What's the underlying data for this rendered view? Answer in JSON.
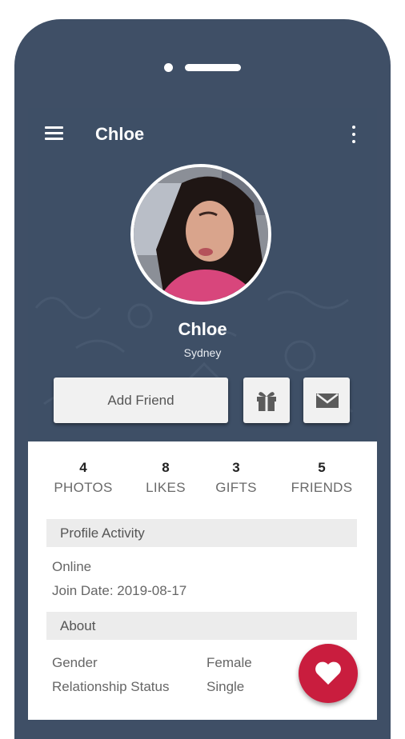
{
  "appbar": {
    "title": "Chloe",
    "menu_icon": "hamburger-menu-icon",
    "more_icon": "more-vertical-icon"
  },
  "profile": {
    "name": "Chloe",
    "city": "Sydney",
    "avatar": "profile-photo"
  },
  "actions": {
    "add_friend_label": "Add Friend",
    "gift_icon": "gift-icon",
    "mail_icon": "mail-icon"
  },
  "stats": [
    {
      "count": "4",
      "label": "PHOTOS"
    },
    {
      "count": "8",
      "label": "LIKES"
    },
    {
      "count": "3",
      "label": "GIFTS"
    },
    {
      "count": "5",
      "label": "FRIENDS"
    }
  ],
  "profile_activity": {
    "header": "Profile Activity",
    "status": "Online",
    "join_date": "Join Date: 2019-08-17"
  },
  "about": {
    "header": "About",
    "rows": [
      {
        "label": "Gender",
        "value": "Female"
      },
      {
        "label": "Relationship Status",
        "value": "Single"
      }
    ]
  },
  "fab": {
    "icon": "heart-icon"
  },
  "colors": {
    "phone_frame": "#3f4f66",
    "hero_background": "#3e4f66",
    "accent": "#c91d3e",
    "section_header": "#ececec"
  }
}
